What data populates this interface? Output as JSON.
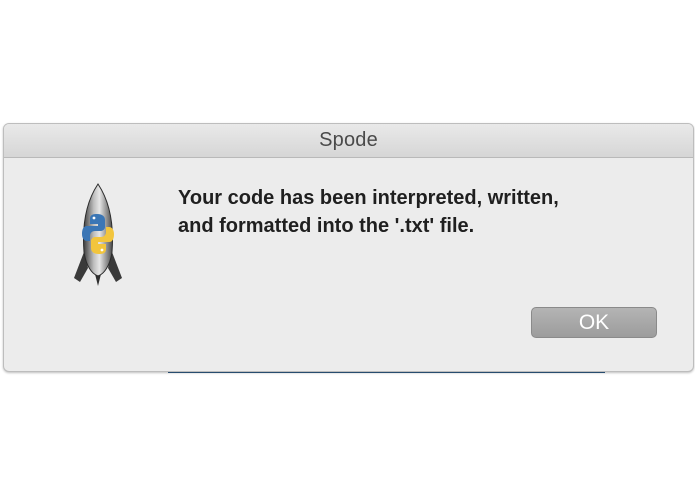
{
  "window": {
    "title": "Spode"
  },
  "dialog": {
    "icon": "rocket-python-app-icon",
    "message_line_1": "Your code has been interpreted, written,",
    "message_line_2": "and formatted into the '.txt' file.",
    "ok_label": "OK"
  },
  "colors": {
    "dialog_background": "#ececec",
    "button": "#a6a6a6",
    "backdrop_accent": "#2f5c86"
  }
}
